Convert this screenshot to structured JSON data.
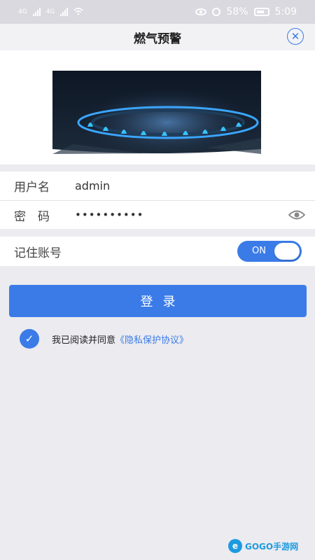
{
  "statusbar": {
    "signal1": "4G",
    "signal2": "4G",
    "battery": "58%",
    "time": "5:09"
  },
  "header": {
    "title": "燃气预警",
    "close_icon": "close-circle-icon"
  },
  "banner": {
    "image": "gas-stove-flame"
  },
  "form": {
    "username_label": "用户名",
    "username_value": "admin",
    "password_label": "密　码",
    "password_value": "••••••••••",
    "eye_icon": "eye-icon"
  },
  "remember": {
    "label": "记住账号",
    "toggle_text": "ON",
    "toggle_state": true
  },
  "login": {
    "label": "登录"
  },
  "agreement": {
    "checked": true,
    "text": "我已阅读并同意",
    "link": "《隐私保护协议》"
  },
  "watermark": {
    "text": "GOGO手游网"
  },
  "colors": {
    "accent": "#3a7be8",
    "background": "#ebebf0",
    "statusbar": "#d9d9df"
  }
}
